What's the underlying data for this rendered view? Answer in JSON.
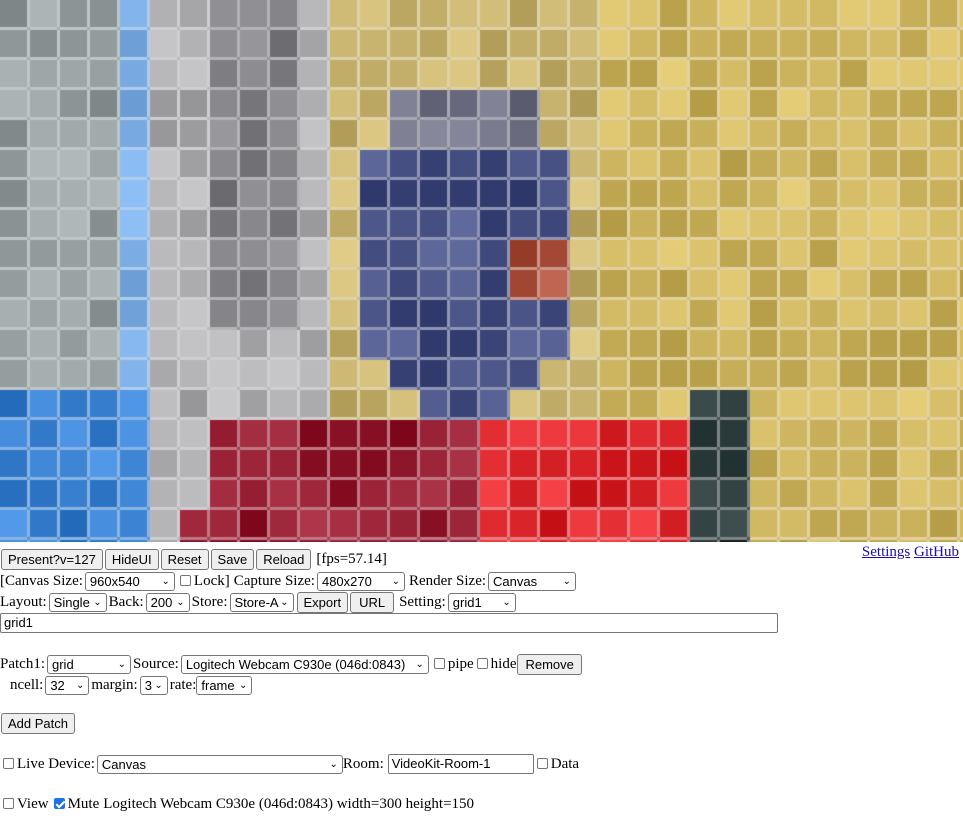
{
  "toolbar": {
    "present_label": "Present?v=127",
    "hideui_label": "HideUI",
    "reset_label": "Reset",
    "save_label": "Save",
    "reload_label": "Reload",
    "fps_text": "[fps=57.14]"
  },
  "links": {
    "settings": "Settings",
    "github": "GitHub"
  },
  "sizes": {
    "canvas_size_label": "[Canvas Size:",
    "canvas_size_value": "960x540",
    "lock_label": "Lock]",
    "capture_size_label": "Capture Size:",
    "capture_size_value": "480x270",
    "render_size_label": "Render Size:",
    "render_size_value": "Canvas"
  },
  "layout_row": {
    "layout_label": "Layout:",
    "layout_value": "Single",
    "back_label": "Back:",
    "back_value": "200",
    "store_label": "Store:",
    "store_value": "Store-A",
    "export_label": "Export",
    "url_label": "URL",
    "setting_label": "Setting:",
    "setting_value": "grid1"
  },
  "setting_name_input": "grid1",
  "patch1": {
    "label": "Patch1:",
    "effect_value": "grid",
    "source_label": "Source:",
    "source_value": "Logitech Webcam C930e (046d:0843)",
    "pipe_label": "pipe",
    "hide_label": "hide",
    "remove_label": "Remove",
    "ncell_label": "ncell:",
    "ncell_value": "32",
    "margin_label": "margin:",
    "margin_value": "3",
    "rate_label": "rate:",
    "rate_value": "frame"
  },
  "add_patch_label": "Add Patch",
  "live": {
    "live_device_label": "Live Device:",
    "live_device_value": "Canvas",
    "room_label": "Room:",
    "room_value": "VideoKit-Room-1",
    "data_label": "Data"
  },
  "view_row": {
    "view_label": "View",
    "mute_label": "Mute",
    "device_info": "Logitech Webcam C930e (046d:0843) width=300 height=150"
  },
  "checkboxes": {
    "lock": false,
    "pipe": false,
    "hide": false,
    "live_device": false,
    "data": false,
    "view": false,
    "mute": true
  }
}
